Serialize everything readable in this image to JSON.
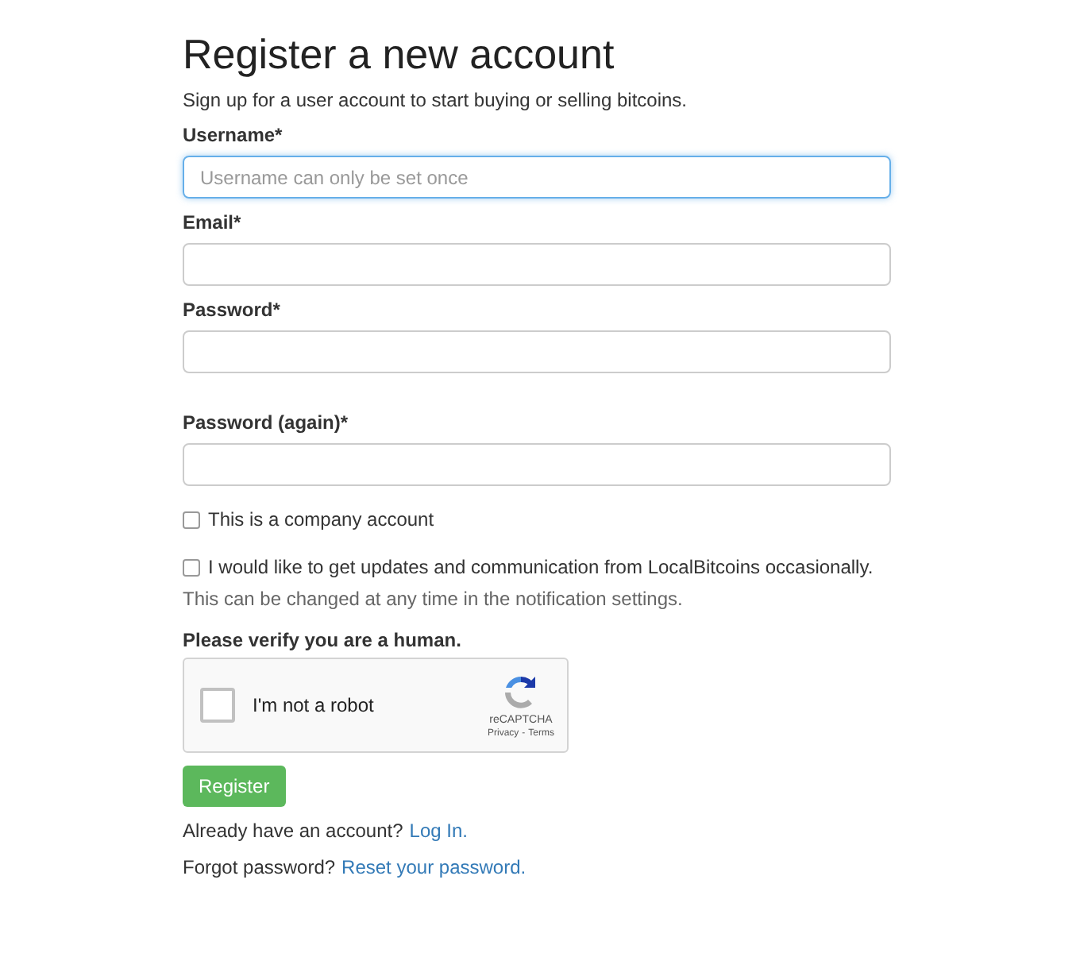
{
  "title": "Register a new account",
  "subtitle": "Sign up for a user account to start buying or selling bitcoins.",
  "fields": [
    {
      "label": "Username*",
      "placeholder": "Username can only be set once",
      "focused": true
    },
    {
      "label": "Email*",
      "focused": false
    },
    {
      "label": "Password*",
      "focused": false
    },
    {
      "label": "Password (again)*",
      "focused": false
    }
  ],
  "checkboxes": [
    {
      "label": "This is a company account",
      "checked": false
    },
    {
      "label": "I would like to get updates and communication from LocalBitcoins occasionally.",
      "checked": false
    }
  ],
  "checkbox_hint": "This can be changed at any time in the notification settings.",
  "captcha": {
    "heading": "Please verify you are a human.",
    "label": "I'm not a robot",
    "checked": false,
    "brand": "reCAPTCHA",
    "privacy": "Privacy",
    "separator": "-",
    "terms": "Terms"
  },
  "register_button": "Register",
  "links": [
    {
      "text": "Already have an account?",
      "link": "Log In."
    },
    {
      "text": "Forgot password?",
      "link": "Reset your password."
    }
  ]
}
